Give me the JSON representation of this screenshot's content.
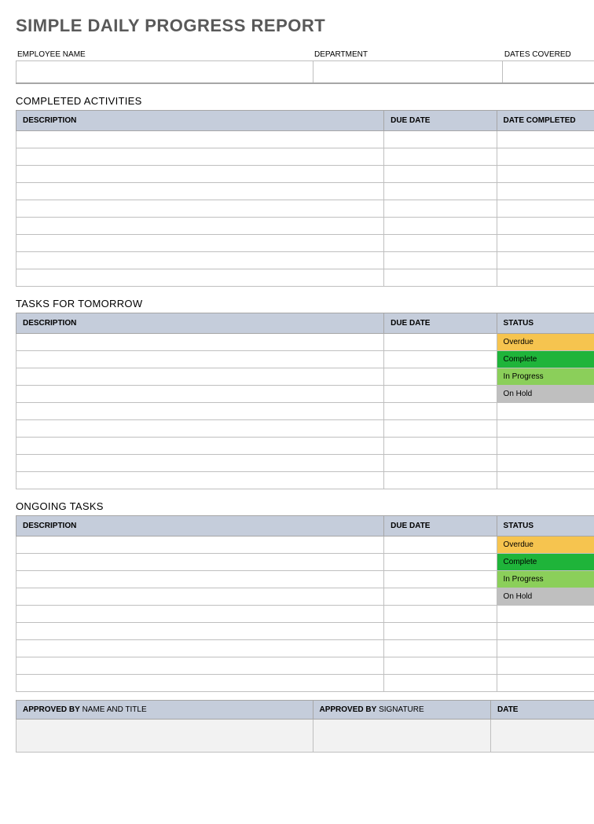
{
  "title": "SIMPLE DAILY PROGRESS REPORT",
  "info": {
    "employee_label": "EMPLOYEE NAME",
    "department_label": "DEPARTMENT",
    "dates_label": "DATES COVERED",
    "employee_value": "",
    "department_value": "",
    "dates_value": ""
  },
  "completed": {
    "heading": "COMPLETED ACTIVITIES",
    "cols": {
      "desc": "DESCRIPTION",
      "due": "DUE DATE",
      "done": "DATE COMPLETED"
    },
    "rows": 9
  },
  "tomorrow": {
    "heading": "TASKS FOR TOMORROW",
    "cols": {
      "desc": "DESCRIPTION",
      "due": "DUE DATE",
      "status": "STATUS"
    },
    "rows": 9,
    "status_seed": [
      "Overdue",
      "Complete",
      "In Progress",
      "On Hold"
    ]
  },
  "ongoing": {
    "heading": "ONGOING TASKS",
    "cols": {
      "desc": "DESCRIPTION",
      "due": "DUE DATE",
      "status": "STATUS"
    },
    "rows": 9,
    "status_seed": [
      "Overdue",
      "Complete",
      "In Progress",
      "On Hold"
    ]
  },
  "approval": {
    "by_label_bold": "APPROVED BY",
    "by_label_rest": " NAME AND TITLE",
    "sig_label_bold": "APPROVED BY",
    "sig_label_rest": " SIGNATURE",
    "date_label": "DATE"
  },
  "status_classes": {
    "Overdue": "status-overdue",
    "Complete": "status-complete",
    "In Progress": "status-inprogress",
    "On Hold": "status-onhold"
  }
}
